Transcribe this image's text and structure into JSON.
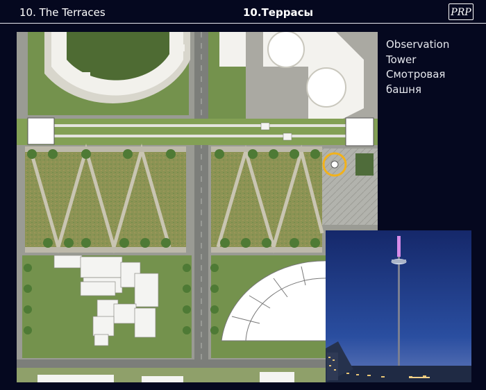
{
  "header": {
    "title_en": "10. The Terraces",
    "title_ru": "10.Террасы",
    "logo_text": "PRP"
  },
  "label": {
    "line1": "Observation",
    "line2": "Tower",
    "line3": "Смотровая",
    "line4": "башня"
  },
  "colors": {
    "background": "#05081f",
    "text": "#ffffff",
    "highlight_ring": "#f2b21b",
    "lawn": "#7a9a52",
    "meadow": "#8f9456",
    "paving": "#a8a8a0",
    "building": "#f4f4f2",
    "sky": "#1a2f74",
    "tower_light": "#d68be8"
  },
  "plan": {
    "highlight_icon": "circle-marker-icon"
  },
  "photo": {
    "subject": "observation tower at dusk"
  }
}
